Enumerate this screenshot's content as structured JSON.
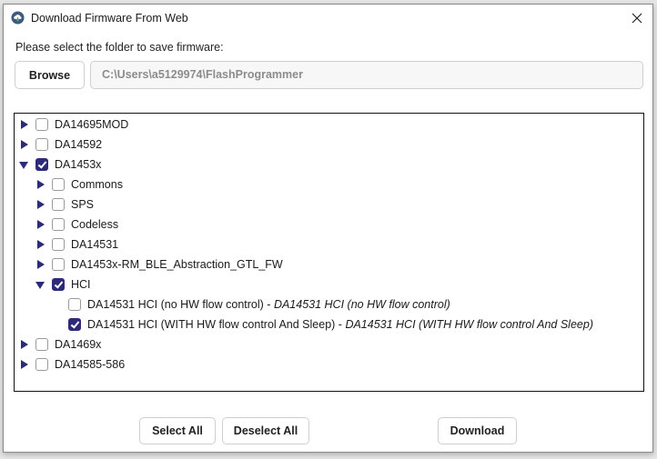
{
  "window": {
    "title": "Download Firmware From Web",
    "icon": "cloud-download-icon",
    "close_icon": "close-icon"
  },
  "folder": {
    "prompt": "Please select the folder to save firmware:",
    "browse_label": "Browse",
    "path_value": "C:\\Users\\a5129974\\FlashProgrammer"
  },
  "colors": {
    "accent": "#2e2a7a",
    "path_text": "#8c8c8c"
  },
  "tree": {
    "items": [
      {
        "label": "DA14695MOD",
        "level": 0,
        "expanded": false,
        "checked": false
      },
      {
        "label": "DA14592",
        "level": 0,
        "expanded": false,
        "checked": false
      },
      {
        "label": "DA1453x",
        "level": 0,
        "expanded": true,
        "checked": true
      },
      {
        "label": "Commons",
        "level": 1,
        "expanded": false,
        "checked": false
      },
      {
        "label": "SPS",
        "level": 1,
        "expanded": false,
        "checked": false
      },
      {
        "label": "Codeless",
        "level": 1,
        "expanded": false,
        "checked": false
      },
      {
        "label": "DA14531",
        "level": 1,
        "expanded": false,
        "checked": false
      },
      {
        "label": "DA1453x-RM_BLE_Abstraction_GTL_FW",
        "level": 1,
        "expanded": false,
        "checked": false
      },
      {
        "label": "HCI",
        "level": 1,
        "expanded": true,
        "checked": true
      },
      {
        "label": "DA14531 HCI (no HW flow control)",
        "description": "DA14531 HCI (no HW flow control)",
        "level": 2,
        "leaf": true,
        "checked": false
      },
      {
        "label": "DA14531 HCI (WITH HW flow control And Sleep)",
        "description": "DA14531 HCI (WITH HW flow control And Sleep)",
        "level": 2,
        "leaf": true,
        "checked": true
      },
      {
        "label": "DA1469x",
        "level": 0,
        "expanded": false,
        "checked": false
      },
      {
        "label": "DA14585-586",
        "level": 0,
        "expanded": false,
        "checked": false
      }
    ],
    "separator": " - "
  },
  "buttons": {
    "select_all": "Select All",
    "deselect_all": "Deselect All",
    "download": "Download"
  }
}
